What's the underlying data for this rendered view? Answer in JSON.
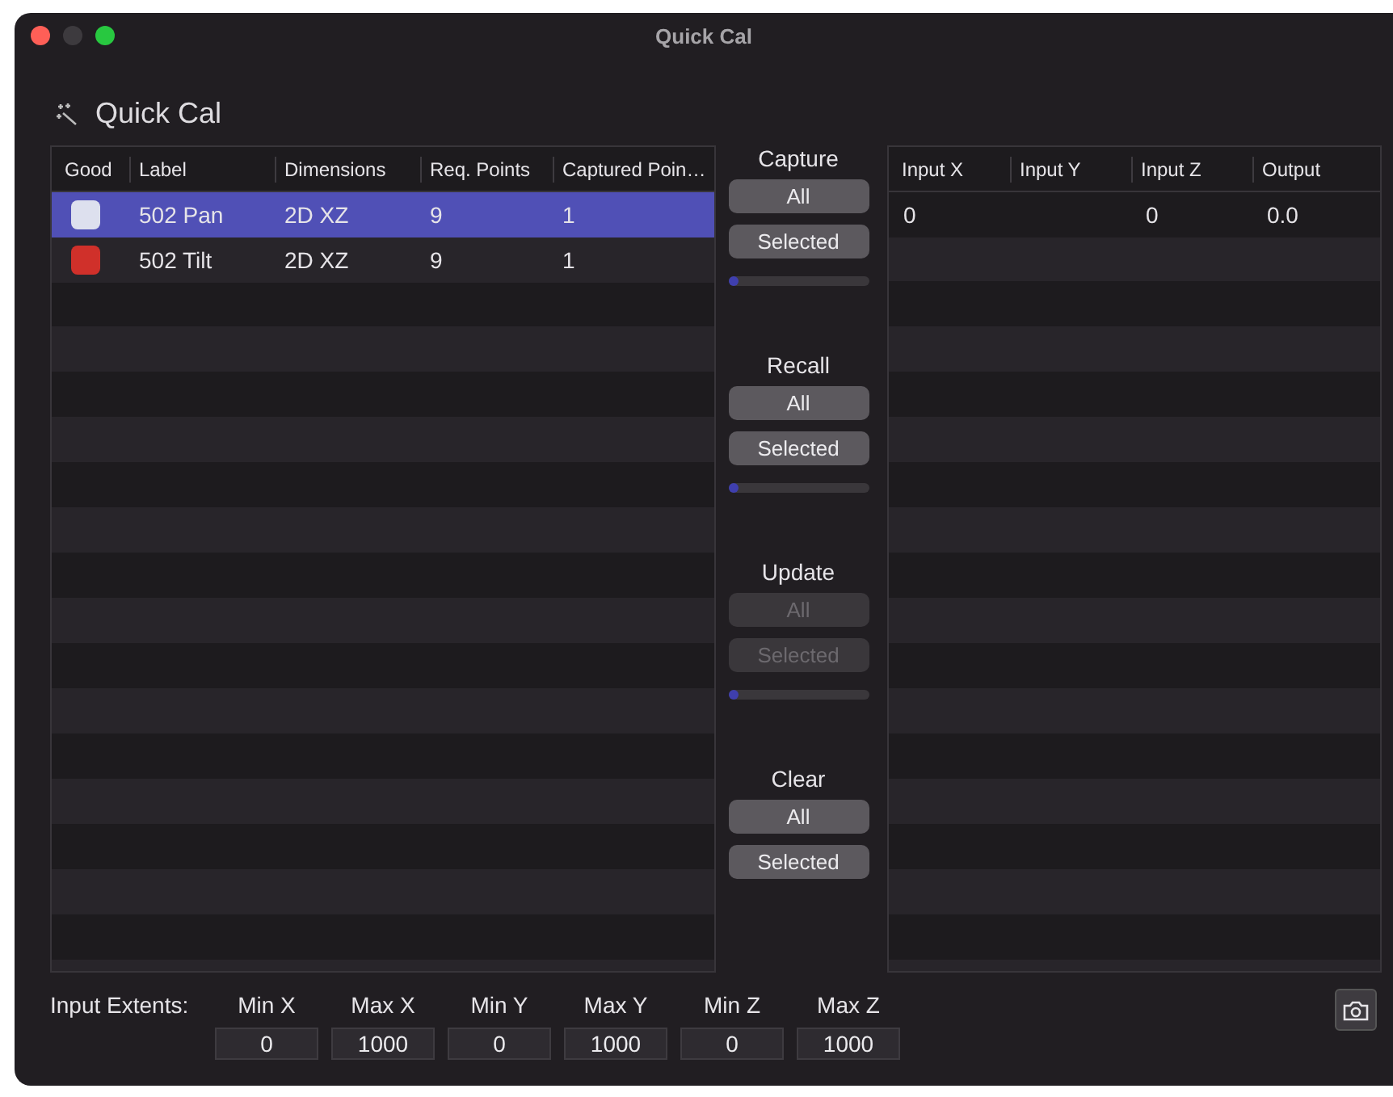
{
  "window": {
    "title": "Quick Cal"
  },
  "header": {
    "title": "Quick Cal"
  },
  "calibrations": {
    "columns": [
      "Good",
      "Label",
      "Dimensions",
      "Req. Points",
      "Captured Poin…"
    ],
    "rows": [
      {
        "color": "#dde0ee",
        "label": "502 Pan",
        "dimensions": "2D XZ",
        "req_points": "9",
        "captured_points": "1",
        "selected": true
      },
      {
        "color": "#d0302a",
        "label": "502 Tilt",
        "dimensions": "2D XZ",
        "req_points": "9",
        "captured_points": "1",
        "selected": false
      }
    ]
  },
  "actions": [
    {
      "title": "Capture",
      "buttons": [
        {
          "label": "All",
          "disabled": false
        },
        {
          "label": "Selected",
          "disabled": false
        }
      ],
      "progress": {
        "level": 0.05
      }
    },
    {
      "title": "Recall",
      "buttons": [
        {
          "label": "All",
          "disabled": false
        },
        {
          "label": "Selected",
          "disabled": false
        }
      ],
      "progress": {
        "level": 0.05
      }
    },
    {
      "title": "Update",
      "buttons": [
        {
          "label": "All",
          "disabled": true
        },
        {
          "label": "Selected",
          "disabled": true
        }
      ],
      "progress": {
        "level": 0.05
      }
    },
    {
      "title": "Clear",
      "buttons": [
        {
          "label": "All",
          "disabled": false
        },
        {
          "label": "Selected",
          "disabled": false
        }
      ]
    }
  ],
  "points": {
    "columns": [
      "Input X",
      "Input Y",
      "Input Z",
      "Output"
    ],
    "rows": [
      [
        "0",
        "",
        "0",
        "0.0"
      ]
    ]
  },
  "input_extents": {
    "label": "Input Extents:",
    "fields": [
      {
        "label": "Min X",
        "value": "0"
      },
      {
        "label": "Max X",
        "value": "1000"
      },
      {
        "label": "Min Y",
        "value": "0"
      },
      {
        "label": "Max Y",
        "value": "1000"
      },
      {
        "label": "Min Z",
        "value": "0"
      },
      {
        "label": "Max Z",
        "value": "1000"
      }
    ]
  }
}
